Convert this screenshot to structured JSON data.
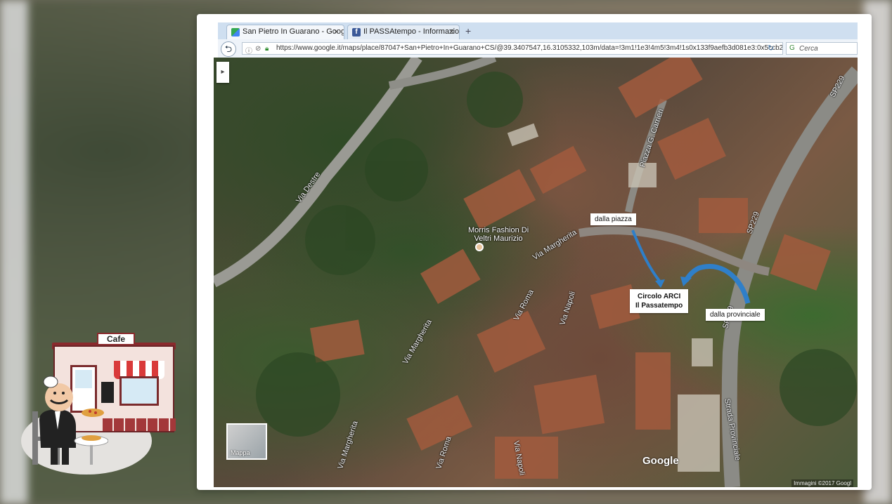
{
  "browser": {
    "tabs": [
      {
        "label": "San Pietro In Guarano - Goog",
        "close": "✕"
      },
      {
        "label": "Il PASSAtempo - Informazion",
        "close": "✕"
      }
    ],
    "new_tab": "+",
    "url": "https://www.google.it/maps/place/87047+San+Pietro+In+Guarano+CS/@39.3407547,16.3105332,103m/data=!3m1!1e3!4m5!3m4!1s0x133f9aefb3d081e3:0x5ccb2",
    "search_placeholder": "Cerca"
  },
  "map": {
    "side_toggle": "▸",
    "streets": {
      "via_destre": "Via Destre",
      "piazza_carrieri": "Piazza G. Carrieri",
      "sp229_top": "SP229",
      "sp229_mid": "SP229",
      "sp229_low": "SP229",
      "via_margherita_1": "Via Margherita",
      "via_margherita_2": "Via Margherita",
      "via_margherita_3": "Via Margherita",
      "via_roma_1": "Via Roma",
      "via_roma_2": "Via Roma",
      "via_napoli_1": "Via Napoli",
      "via_napoli_2": "Via Napoli",
      "strada_provinciale": "Strada Provinciale"
    },
    "poi": {
      "line1": "Morris Fashion Di",
      "line2": "Veltri Maurizio"
    },
    "callouts": {
      "dalla_piazza": "dalla piazza",
      "circolo_line1": "Circolo ARCI",
      "circolo_line2": "Il Passatempo",
      "dalla_provinciale": "dalla provinciale"
    },
    "mappa_label": "Mappa",
    "logo": "Google",
    "attribution": "Immagini ©2017 Googl",
    "arrow_color": "#2f7fc9"
  },
  "cafe": {
    "sign": "Cafe",
    "colors": {
      "awning": "#d93a3a",
      "frame": "#8a2a2d"
    }
  }
}
